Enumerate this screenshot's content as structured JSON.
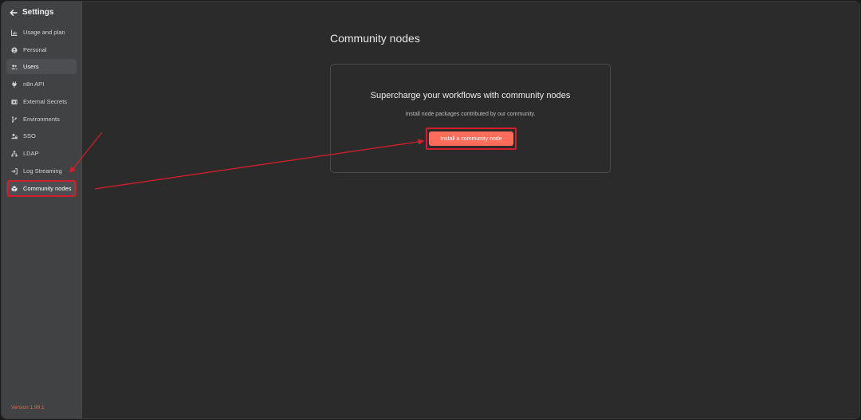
{
  "sidebar": {
    "title": "Settings",
    "items": [
      {
        "label": "Usage and plan",
        "icon": "chart-icon"
      },
      {
        "label": "Personal",
        "icon": "user-circle-icon"
      },
      {
        "label": "Users",
        "icon": "users-icon"
      },
      {
        "label": "n8n API",
        "icon": "plug-icon"
      },
      {
        "label": "External Secrets",
        "icon": "vault-icon"
      },
      {
        "label": "Environments",
        "icon": "branch-icon"
      },
      {
        "label": "SSO",
        "icon": "user-lock-icon"
      },
      {
        "label": "LDAP",
        "icon": "network-icon"
      },
      {
        "label": "Log Streaming",
        "icon": "sign-in-icon"
      },
      {
        "label": "Community nodes",
        "icon": "cube-icon"
      }
    ],
    "version": "Version 1.99.1"
  },
  "main": {
    "title": "Community nodes",
    "card": {
      "heading": "Supercharge your workflows with community nodes",
      "description": "Install node packages contributed by our community.",
      "button_label": "Install a community node"
    }
  },
  "colors": {
    "accent": "#ff6d5a",
    "annotation": "#d21f2b",
    "sidebar_bg": "#414244",
    "main_bg": "#2b2b2b"
  }
}
